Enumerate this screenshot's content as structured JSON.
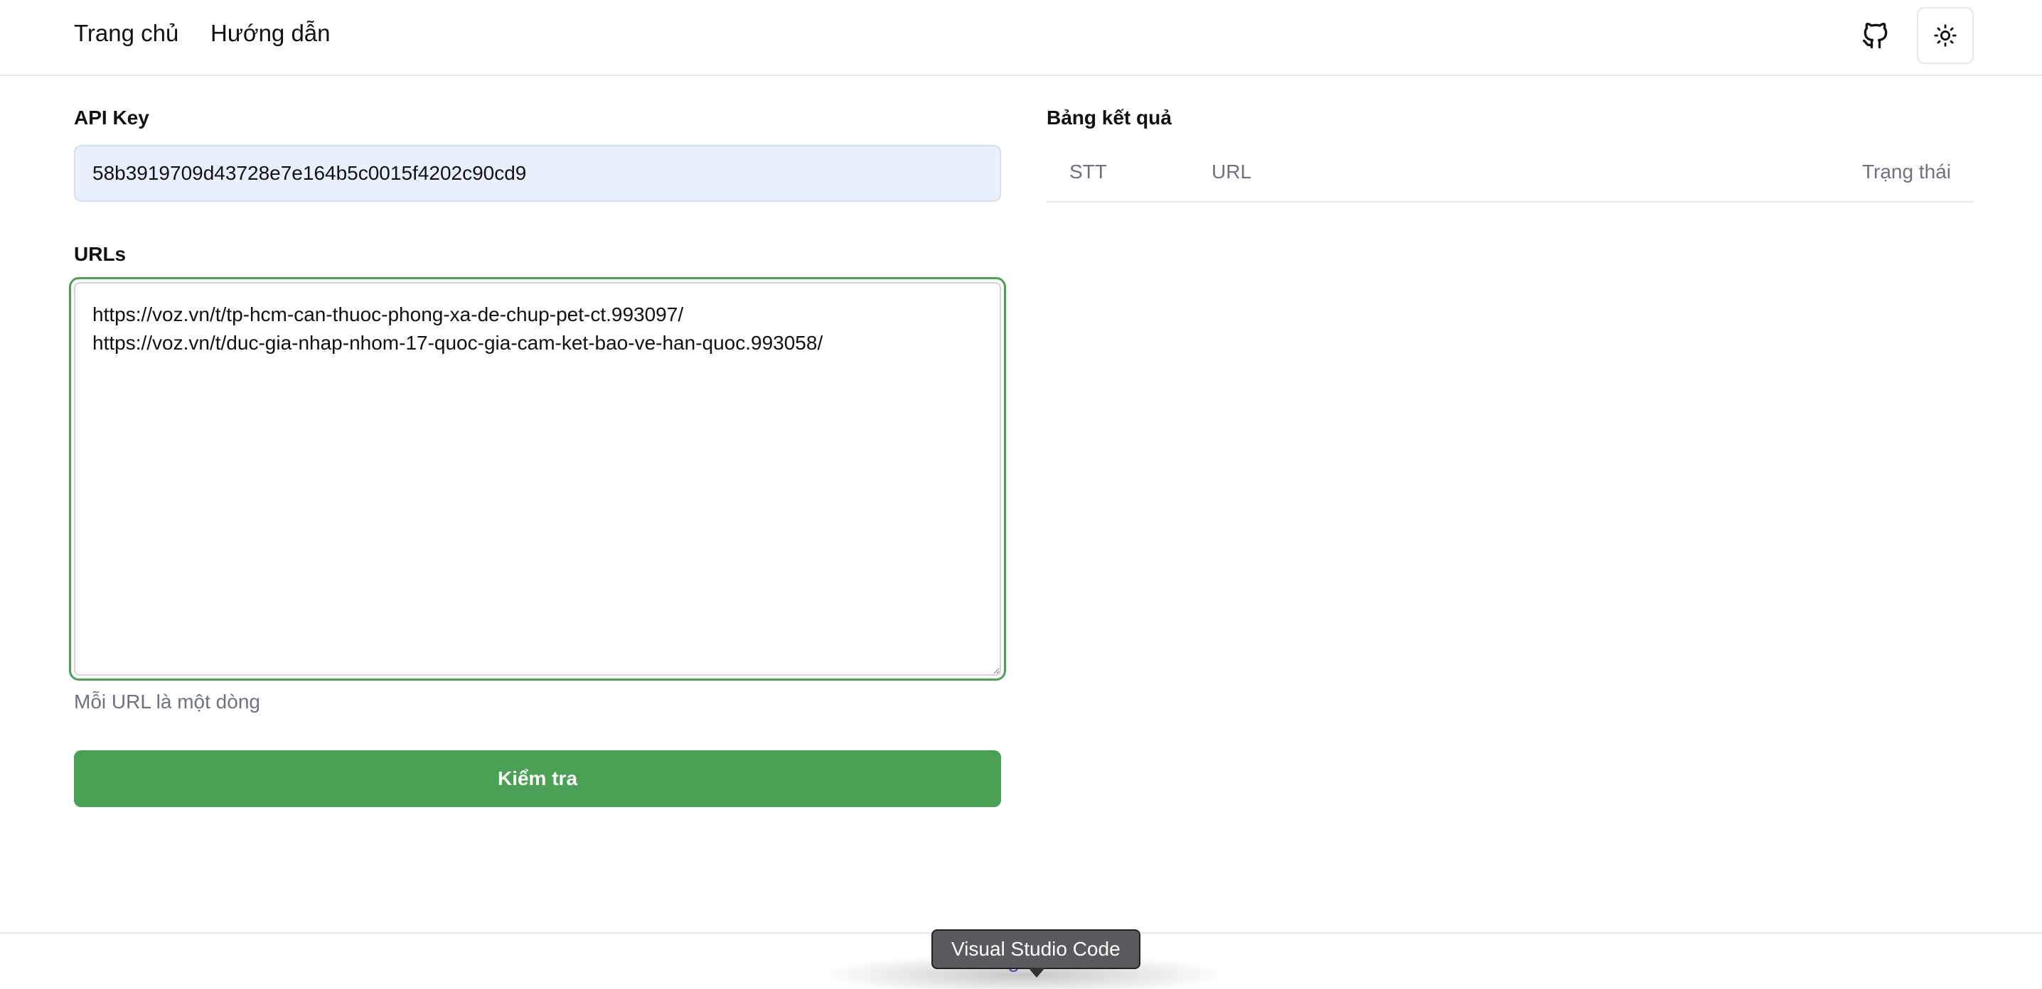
{
  "nav": {
    "home_label": "Trang chủ",
    "guide_label": "Hướng dẫn",
    "github_icon": "github-icon",
    "theme_icon": "sun-icon"
  },
  "form": {
    "api_key_label": "API Key",
    "api_key_value": "58b3919709d43728e7e164b5c0015f4202c90cd9",
    "urls_label": "URLs",
    "urls_value": "https://voz.vn/t/tp-hcm-can-thuoc-phong-xa-de-chup-pet-ct.993097/\nhttps://voz.vn/t/duc-gia-nhap-nhom-17-quoc-gia-cam-ket-bao-ve-han-quoc.993058/",
    "urls_hint": "Mỗi URL là một dòng",
    "submit_label": "Kiểm tra"
  },
  "results": {
    "title": "Bảng kết quả",
    "columns": [
      "STT",
      "URL",
      "Trạng thái"
    ],
    "rows": []
  },
  "footer": {
    "credit_fragment": "Tuấn Nguyễn"
  },
  "tooltip": {
    "text": "Visual Studio Code"
  },
  "colors": {
    "accent": "#4aa155",
    "input_bg": "#e8f0fe",
    "muted_text": "#6b7280",
    "border": "#e5e7eb"
  }
}
